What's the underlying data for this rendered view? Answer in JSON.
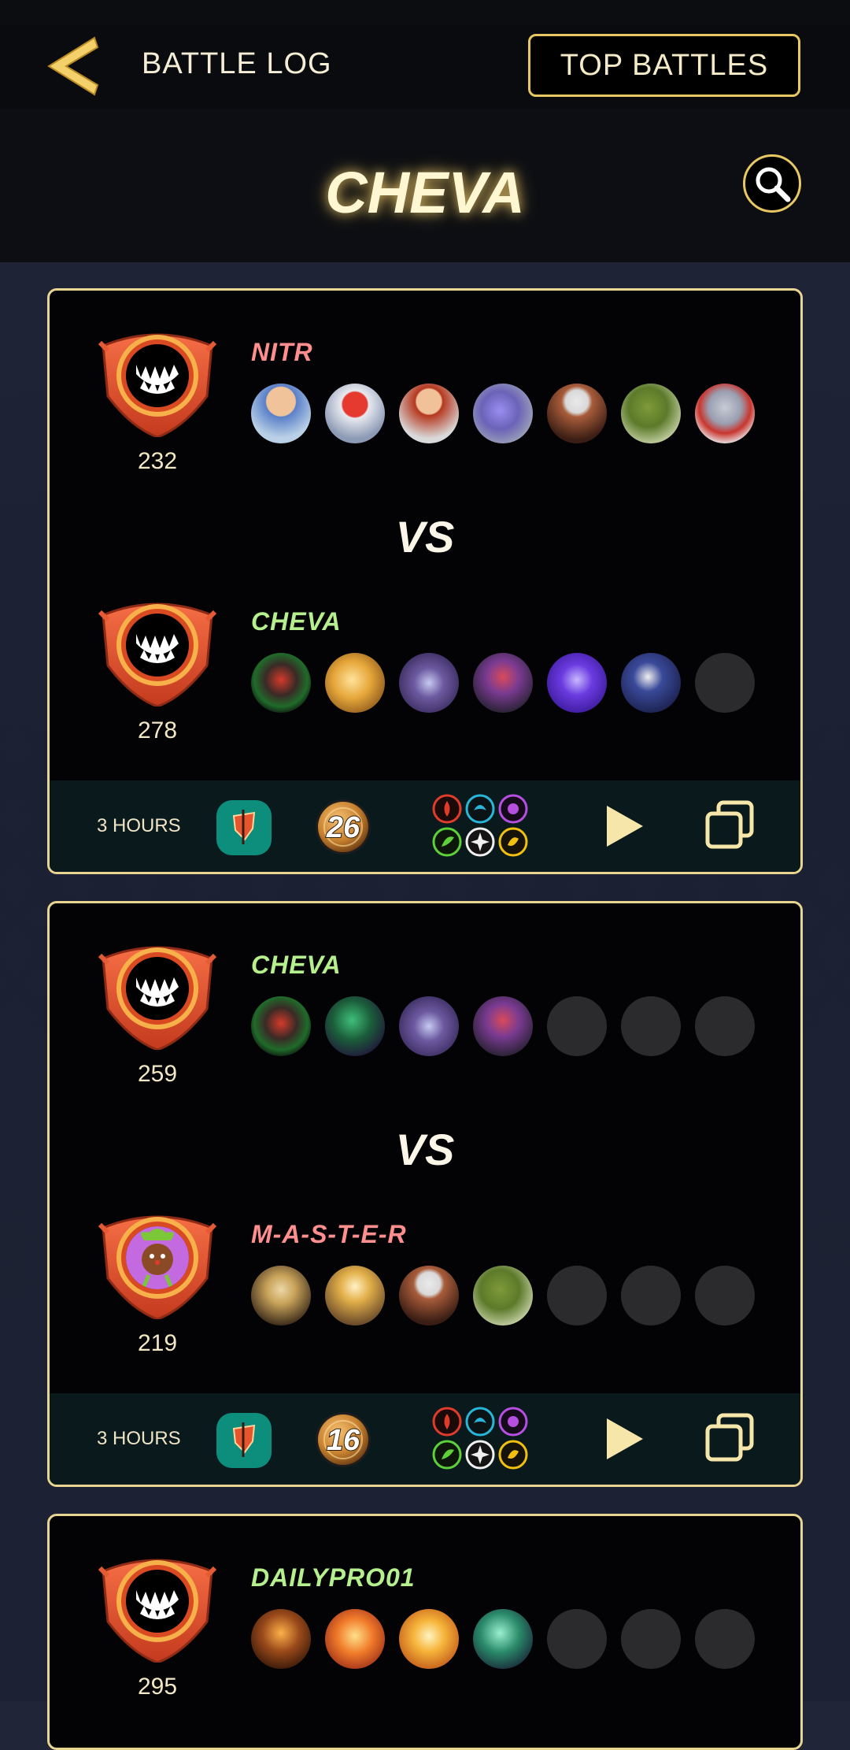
{
  "header": {
    "title": "BATTLE LOG",
    "top_battles_label": "TOP BATTLES"
  },
  "player": {
    "name": "CHEVA"
  },
  "colors": {
    "accent": "#e7c862",
    "winner": "#b6ef8e",
    "loser": "#ff8e8e",
    "footer": "#0a1a1c"
  },
  "battles": [
    {
      "top": {
        "name": "NITR",
        "result": "loser",
        "rating": "232",
        "badge": "monster-mouth-icon",
        "units": [
          "hero-blonde",
          "white-knight",
          "red-warrior",
          "purple-dragon",
          "white-hair-elder",
          "green-beast",
          "armored-grey"
        ]
      },
      "vs": "VS",
      "bottom": {
        "name": "CHEVA",
        "result": "winner",
        "rating": "278",
        "badge": "monster-mouth-icon",
        "units": [
          "dark-lord",
          "golden-dragon",
          "purple-storm",
          "jester-shadow",
          "purple-ghost",
          "blue-swordsman",
          "empty"
        ]
      },
      "footer": {
        "time": "3 HOURS",
        "mana": "26",
        "ruleset_icon": "banner-icon"
      }
    },
    {
      "top": {
        "name": "CHEVA",
        "result": "winner",
        "rating": "259",
        "badge": "monster-mouth-icon",
        "units": [
          "dark-lord",
          "green-swamp",
          "purple-storm",
          "jester-shadow",
          "empty",
          "empty",
          "empty"
        ]
      },
      "vs": "VS",
      "bottom": {
        "name": "M-A-S-T-E-R",
        "result": "loser",
        "rating": "219",
        "badge": "plant-creature-icon",
        "units": [
          "golden-mage",
          "light-priest",
          "white-hair-elder",
          "green-beast",
          "empty",
          "empty",
          "empty"
        ]
      },
      "footer": {
        "time": "3 HOURS",
        "mana": "16",
        "ruleset_icon": "banner-icon"
      }
    },
    {
      "top": {
        "name": "DAILYPRO01",
        "result": "winner",
        "rating": "295",
        "badge": "monster-mouth-icon",
        "units": [
          "fire-wizard",
          "fire-burst",
          "fire-golem",
          "green-knight",
          "empty",
          "empty",
          "empty"
        ]
      }
    }
  ]
}
